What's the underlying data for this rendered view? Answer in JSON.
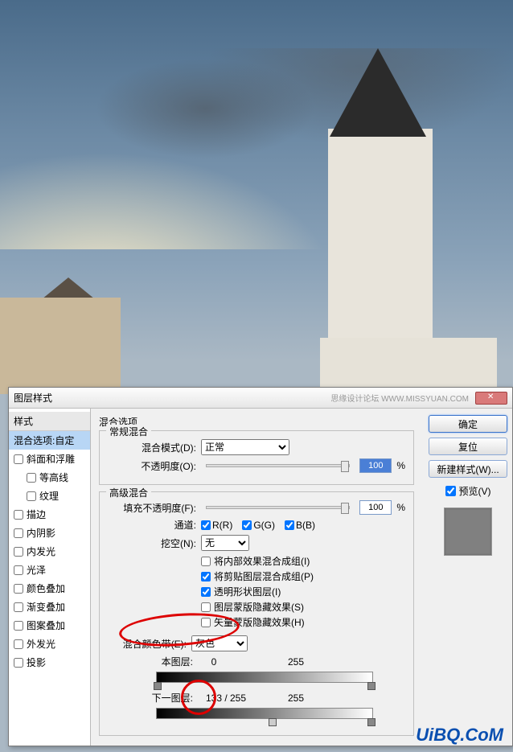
{
  "dialog": {
    "title": "图层样式",
    "watermark": "思缘设计论坛  WWW.MISSYUAN.COM"
  },
  "sidebar": {
    "header": "样式",
    "blending_selected": "混合选项:自定",
    "items": [
      {
        "label": "斜面和浮雕",
        "checked": false
      },
      {
        "label": "等高线",
        "checked": false,
        "sub": true
      },
      {
        "label": "纹理",
        "checked": false,
        "sub": true
      },
      {
        "label": "描边",
        "checked": false
      },
      {
        "label": "内阴影",
        "checked": false
      },
      {
        "label": "内发光",
        "checked": false
      },
      {
        "label": "光泽",
        "checked": false
      },
      {
        "label": "颜色叠加",
        "checked": false
      },
      {
        "label": "渐变叠加",
        "checked": false
      },
      {
        "label": "图案叠加",
        "checked": false
      },
      {
        "label": "外发光",
        "checked": false
      },
      {
        "label": "投影",
        "checked": false
      }
    ]
  },
  "main": {
    "heading": "混合选项",
    "normal_group": "常规混合",
    "blend_mode_label": "混合模式(D):",
    "blend_mode_value": "正常",
    "opacity_label": "不透明度(O):",
    "opacity_value": "100",
    "percent": "%",
    "advanced_group": "高级混合",
    "fill_opacity_label": "填充不透明度(F):",
    "fill_opacity_value": "100",
    "channels_label": "通道:",
    "channels": [
      {
        "label": "R(R)",
        "checked": true
      },
      {
        "label": "G(G)",
        "checked": true
      },
      {
        "label": "B(B)",
        "checked": true
      }
    ],
    "knockout_label": "挖空(N):",
    "knockout_value": "无",
    "checks": [
      {
        "label": "将内部效果混合成组(I)",
        "checked": false
      },
      {
        "label": "将剪贴图层混合成组(P)",
        "checked": true
      },
      {
        "label": "透明形状图层(I)",
        "checked": true
      },
      {
        "label": "图层蒙版隐藏效果(S)",
        "checked": false
      },
      {
        "label": "矢量蒙版隐藏效果(H)",
        "checked": false
      }
    ],
    "blendif_label": "混合颜色带(E):",
    "blendif_value": "灰色",
    "this_layer_label": "本图层:",
    "this_layer_vals": [
      "0",
      "255"
    ],
    "underlying_label": "下一图层:",
    "underlying_vals": [
      "133 / 255",
      "255"
    ]
  },
  "buttons": {
    "ok": "确定",
    "cancel": "复位",
    "new_style": "新建样式(W)...",
    "preview": "预览(V)"
  },
  "footer": "UiBQ.CoM",
  "chart_data": null
}
